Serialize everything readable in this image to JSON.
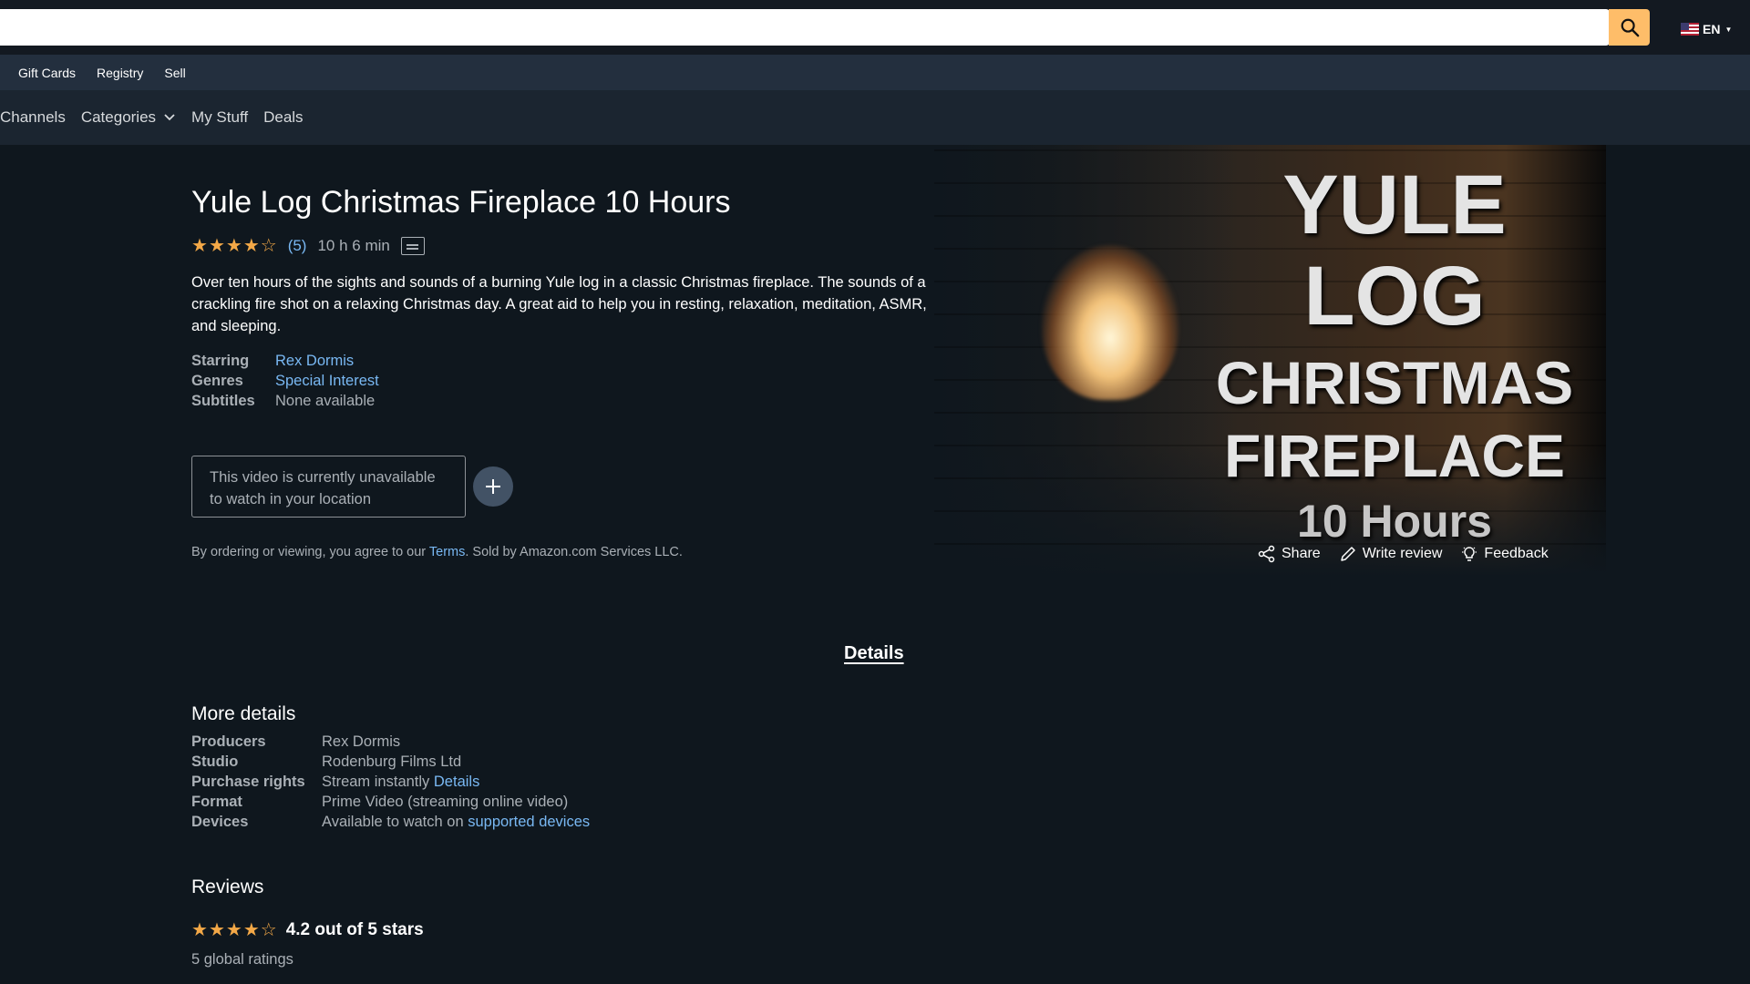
{
  "header": {
    "search": {
      "placeholder": ""
    },
    "language": "EN",
    "colors": {
      "search_button": "#febd69",
      "nav_bg": "#131921"
    }
  },
  "subnav": {
    "items": [
      "Gift Cards",
      "Registry",
      "Sell"
    ]
  },
  "pv_nav": {
    "items": [
      "Channels",
      "Categories",
      "My Stuff",
      "Deals"
    ]
  },
  "title": "Yule Log Christmas Fireplace 10 Hours",
  "meta": {
    "rating_stars": 4,
    "rating_count": "(5)",
    "runtime": "10 h 6 min",
    "icon": "subtitles-icon"
  },
  "synopsis": "Over ten hours of the sights and sounds of a burning Yule log in a classic Christmas fireplace. The sounds of a crackling fire shot on a relaxing Christmas day. A great aid to help you in resting, relaxation, meditation, ASMR, and sleeping.",
  "info": {
    "starring_label": "Starring",
    "starring_value": "Rex Dormis",
    "genres_label": "Genres",
    "genres_value": "Special Interest",
    "subtitles_label": "Subtitles",
    "subtitles_value": "None available"
  },
  "unavailable_text": "This video is currently unavailable to watch in your location",
  "terms": {
    "prefix": "By ordering or viewing, you agree to our ",
    "link": "Terms",
    "suffix": ". Sold by Amazon.com Services LLC."
  },
  "hero_art": {
    "line1": "YULE",
    "line2": "LOG",
    "line3": "CHRISTMAS",
    "line4": "FIREPLACE",
    "line5": "10 Hours"
  },
  "actions": {
    "share": "Share",
    "write_review": "Write review",
    "feedback": "Feedback"
  },
  "details_tab": "Details",
  "more_details": {
    "heading": "More details",
    "producers_label": "Producers",
    "producers_value": "Rex Dormis",
    "studio_label": "Studio",
    "studio_value": "Rodenburg Films Ltd",
    "purchase_label": "Purchase rights",
    "purchase_value": "Stream instantly ",
    "purchase_link": "Details",
    "format_label": "Format",
    "format_value": "Prime Video (streaming online video)",
    "devices_label": "Devices",
    "devices_value": "Available to watch on ",
    "devices_link": "supported devices"
  },
  "reviews": {
    "heading": "Reviews",
    "stars": 4,
    "score_text": "4.2 out of 5 stars",
    "global_ratings": "5 global ratings"
  }
}
